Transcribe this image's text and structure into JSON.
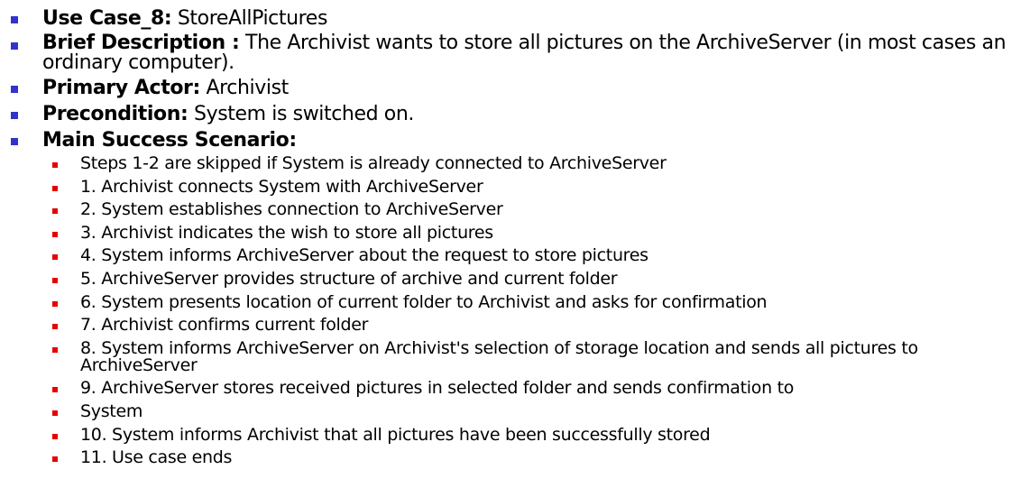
{
  "colors": {
    "level1_bullet": "#3333cc",
    "level2_bullet": "#e60000"
  },
  "items": [
    {
      "label": "Use Case_8:",
      "text": " StoreAllPictures"
    },
    {
      "label": "Brief Description :",
      "text": " The Archivist wants to store all pictures on the ArchiveServer (in most cases an ordinary computer)."
    },
    {
      "label": "Primary Actor:",
      "text": " Archivist"
    },
    {
      "label": "Precondition:",
      "text": " System is switched on."
    },
    {
      "label": "Main Success Scenario:",
      "text": ""
    }
  ],
  "steps": [
    "Steps 1-2 are skipped if System is already connected to ArchiveServer",
    "1. Archivist connects System with ArchiveServer",
    "2. System establishes connection to ArchiveServer",
    "3. Archivist indicates the wish to store all pictures",
    "4. System informs ArchiveServer about the request to store pictures",
    "5. ArchiveServer provides structure of archive and current folder",
    "6. System presents location of current folder to Archivist and asks for confirmation",
    "7. Archivist confirms current folder",
    "8. System informs ArchiveServer on Archivist's selection of storage location and sends all pictures to ArchiveServer",
    "9. ArchiveServer stores received pictures in selected folder and sends confirmation to",
    "System",
    "10. System informs Archivist that all pictures have been successfully stored",
    "11. Use case ends"
  ]
}
